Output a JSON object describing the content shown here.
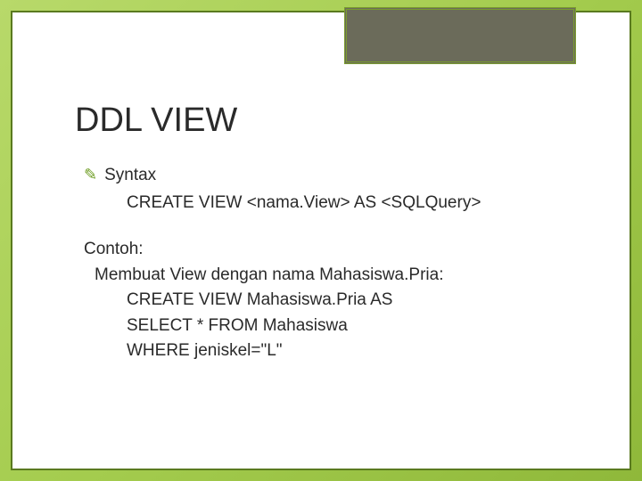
{
  "slide": {
    "title": "DDL VIEW",
    "bullet_label": "Syntax",
    "syntax_line": "CREATE VIEW <nama.View> AS <SQLQuery>",
    "example_label": "Contoh:",
    "example_desc": "Membuat View dengan nama Mahasiswa.Pria:",
    "code_lines": [
      "CREATE VIEW Mahasiswa.Pria AS",
      "SELECT * FROM Mahasiswa",
      "WHERE jeniskel=\"L\""
    ]
  }
}
